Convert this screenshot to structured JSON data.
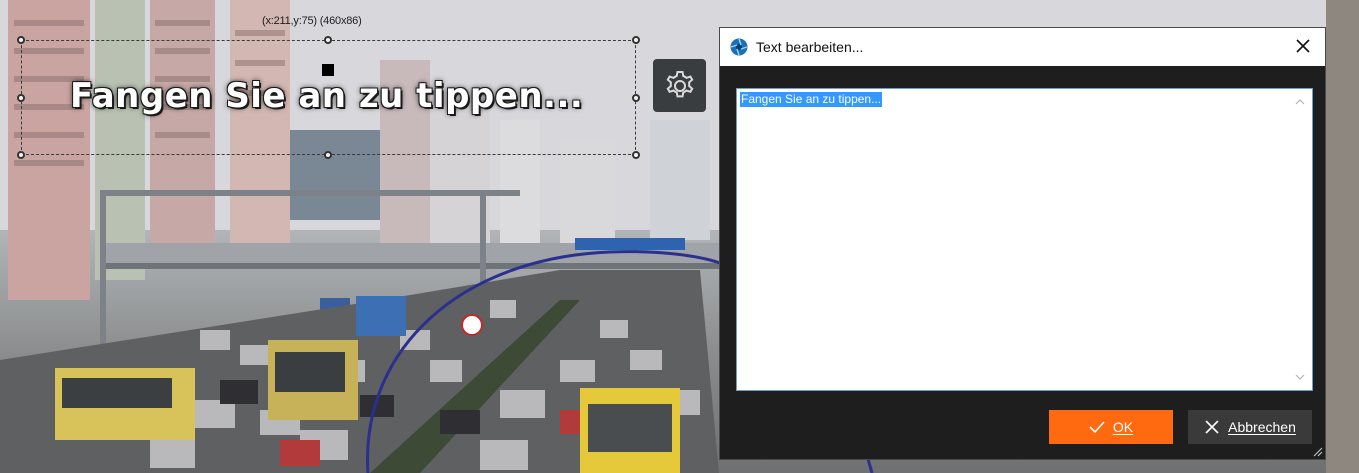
{
  "canvas": {
    "coordinates_label": "(x:211,y:75) (460x86)",
    "text_object": "Fangen Sie an zu tippen...",
    "settings_icon": "gear-icon"
  },
  "dialog": {
    "title": "Text bearbeiten...",
    "app_icon": "aperture-icon",
    "close_icon": "close-icon",
    "editor_value": "Fangen Sie an zu tippen...",
    "ok_label": "OK",
    "cancel_label": "Abbrechen",
    "ok_icon": "checkmark-icon",
    "cancel_icon": "cross-icon",
    "colors": {
      "ok_button": "#ff6a10",
      "selection": "#3399ff",
      "dialog_background": "#1e1e1e"
    }
  }
}
